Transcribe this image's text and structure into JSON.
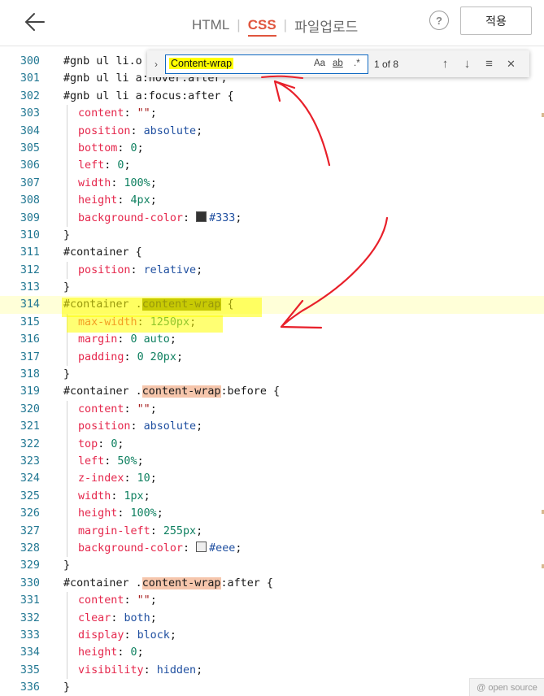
{
  "toolbar": {
    "tabs": [
      {
        "label": "HTML",
        "active": false
      },
      {
        "label": "CSS",
        "active": true
      },
      {
        "label": "파일업로드",
        "active": false
      }
    ],
    "help_label": "?",
    "apply_label": "적용"
  },
  "find": {
    "query": "Content-wrap",
    "match_case": "Aa",
    "whole_word": "ab",
    "regex": ".*",
    "count": "1 of 8",
    "toggle": "›",
    "prev": "↑",
    "next": "↓",
    "selection": "≡",
    "close": "✕"
  },
  "editor": {
    "lines": [
      {
        "num": "300",
        "code": "#gnb ul li.o",
        "ind": false
      },
      {
        "num": "301",
        "code": "#gnb ul li a:hover:after,",
        "ind": false
      },
      {
        "num": "302",
        "code": "#gnb ul li a:focus:after {",
        "ind": false
      },
      {
        "num": "303",
        "prop": "content",
        "val": "\"\"",
        "vclass": "s",
        "ind": true
      },
      {
        "num": "304",
        "prop": "position",
        "val": "absolute",
        "vclass": "v",
        "ind": true
      },
      {
        "num": "305",
        "prop": "bottom",
        "val": "0",
        "vclass": "n",
        "ind": true
      },
      {
        "num": "306",
        "prop": "left",
        "val": "0",
        "vclass": "n",
        "ind": true
      },
      {
        "num": "307",
        "prop": "width",
        "val": "100%",
        "vclass": "n",
        "ind": true
      },
      {
        "num": "308",
        "prop": "height",
        "val": "4px",
        "vclass": "n",
        "ind": true
      },
      {
        "num": "309",
        "prop": "background-color",
        "val": "#333",
        "vclass": "v",
        "swatch": "#333333",
        "ind": true
      },
      {
        "num": "310",
        "code": "}",
        "ind": false
      },
      {
        "num": "311",
        "code": "#container {",
        "ind": false
      },
      {
        "num": "312",
        "prop": "position",
        "val": "relative",
        "vclass": "v",
        "ind": true
      },
      {
        "num": "313",
        "code": "}",
        "ind": false
      },
      {
        "num": "314",
        "pre": "#container .",
        "match": "content-wrap",
        "post": " {",
        "current": true,
        "matchclass": "m1",
        "ind": false
      },
      {
        "num": "315",
        "prop": "max-width",
        "val": "1250px",
        "vclass": "n",
        "ind": true
      },
      {
        "num": "316",
        "prop": "margin",
        "val": "0 auto",
        "vclass": "n",
        "ind": true
      },
      {
        "num": "317",
        "prop": "padding",
        "val": "0 20px",
        "vclass": "n",
        "ind": true
      },
      {
        "num": "318",
        "code": "}",
        "ind": false
      },
      {
        "num": "319",
        "pre": "#container .",
        "match": "content-wrap",
        "post": ":before {",
        "matchclass": "m",
        "ind": false
      },
      {
        "num": "320",
        "prop": "content",
        "val": "\"\"",
        "vclass": "s",
        "ind": true
      },
      {
        "num": "321",
        "prop": "position",
        "val": "absolute",
        "vclass": "v",
        "ind": true
      },
      {
        "num": "322",
        "prop": "top",
        "val": "0",
        "vclass": "n",
        "ind": true
      },
      {
        "num": "323",
        "prop": "left",
        "val": "50%",
        "vclass": "n",
        "ind": true
      },
      {
        "num": "324",
        "prop": "z-index",
        "val": "10",
        "vclass": "n",
        "ind": true
      },
      {
        "num": "325",
        "prop": "width",
        "val": "1px",
        "vclass": "n",
        "ind": true
      },
      {
        "num": "326",
        "prop": "height",
        "val": "100%",
        "vclass": "n",
        "ind": true
      },
      {
        "num": "327",
        "prop": "margin-left",
        "val": "255px",
        "vclass": "n",
        "ind": true
      },
      {
        "num": "328",
        "prop": "background-color",
        "val": "#eee",
        "vclass": "v",
        "swatch": "#eeeeee",
        "ind": true
      },
      {
        "num": "329",
        "code": "}",
        "ind": false
      },
      {
        "num": "330",
        "pre": "#container .",
        "match": "content-wrap",
        "post": ":after {",
        "matchclass": "m",
        "ind": false
      },
      {
        "num": "331",
        "prop": "content",
        "val": "\"\"",
        "vclass": "s",
        "ind": true
      },
      {
        "num": "332",
        "prop": "clear",
        "val": "both",
        "vclass": "v",
        "ind": true
      },
      {
        "num": "333",
        "prop": "display",
        "val": "block",
        "vclass": "v",
        "ind": true
      },
      {
        "num": "334",
        "prop": "height",
        "val": "0",
        "vclass": "n",
        "ind": true
      },
      {
        "num": "335",
        "prop": "visibility",
        "val": "hidden",
        "vclass": "v",
        "ind": true
      },
      {
        "num": "336",
        "code": "}",
        "ind": false
      }
    ]
  },
  "footer": {
    "label": "@ open source"
  },
  "colors": {
    "accent": "#e0553e",
    "annotation": "#e8202a",
    "highlight": "#ffff00"
  }
}
